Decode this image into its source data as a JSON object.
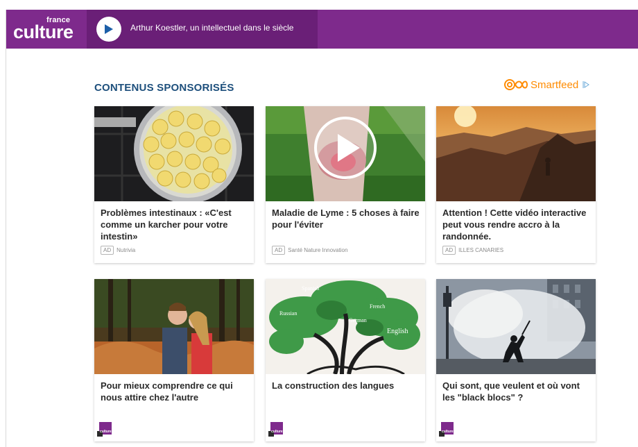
{
  "header": {
    "logo_small": "france",
    "logo_big": "culture",
    "player_title": "Arthur Koestler, un intellectuel dans le siècle"
  },
  "sponsored": {
    "title": "CONTENUS SPONSORISÉS",
    "provider": "Smartfeed"
  },
  "cards": [
    {
      "title": "Problèmes intestinaux : «C'est comme un karcher pour votre intestin»",
      "ad_badge": "AD",
      "source": "Nutrivia",
      "image": "bananas-pot"
    },
    {
      "title": "Maladie de Lyme : 5 choses à faire pour l'éviter",
      "ad_badge": "AD",
      "source": "Santé Nature Innovation",
      "image": "leg-rash-video"
    },
    {
      "title": "Attention ! Cette vidéo interactive peut vous rendre accro à la randonnée.",
      "ad_badge": "AD",
      "source": "ILLES CANARIES",
      "image": "mountain-hiker"
    },
    {
      "title": "Pour mieux comprendre ce qui nous attire chez l'autre",
      "logo_text": "culture",
      "image": "couple-forest"
    },
    {
      "title": "La construction des langues",
      "logo_text": "culture",
      "image": "language-tree"
    },
    {
      "title": "Qui sont, que veulent et où vont les \"black blocs\" ?",
      "logo_text": "culture",
      "image": "riot-smoke"
    }
  ],
  "colors": {
    "brand_purple": "#7e2a8c",
    "section_title": "#1d4f7c",
    "smartfeed_orange": "#ff8b00"
  }
}
